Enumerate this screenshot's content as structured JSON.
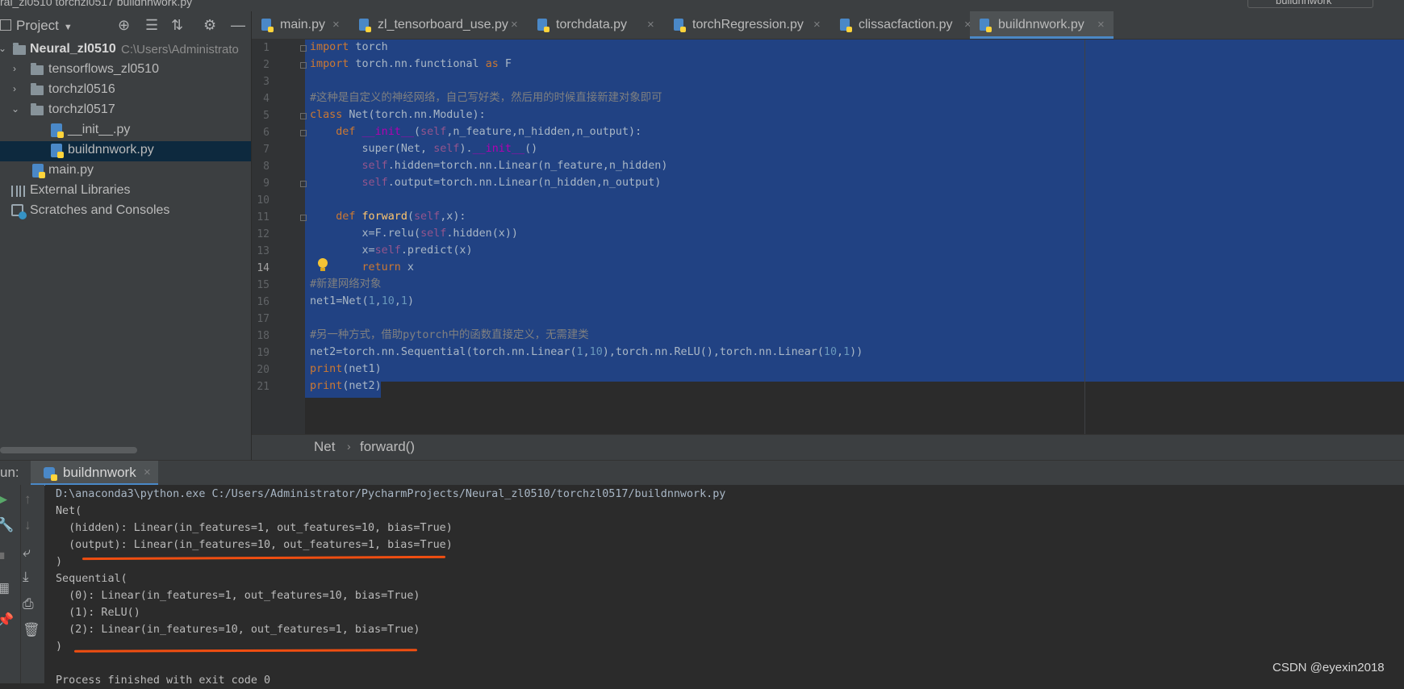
{
  "top_breadcrumb": "ral_zl0510  torchzl0517  buildnnwork.py",
  "run_config_label": "buildnnwork",
  "sidebar": {
    "title": "Project",
    "tools": {
      "locate": "⊕",
      "expand": "☰",
      "collapse": "⇅",
      "settings": "⚙",
      "hide": "—"
    },
    "tree": [
      {
        "label": "Neural_zl0510",
        "hint": "C:\\Users\\Administrato",
        "arrow": "⌄"
      },
      {
        "label": "tensorflows_zl0510",
        "arrow": "›"
      },
      {
        "label": "torchzl0516",
        "arrow": "›"
      },
      {
        "label": "torchzl0517",
        "arrow": "⌄"
      },
      {
        "label": "__init__.py"
      },
      {
        "label": "buildnnwork.py"
      },
      {
        "label": "main.py"
      },
      {
        "label": "External Libraries"
      },
      {
        "label": "Scratches and Consoles"
      }
    ]
  },
  "tabs": [
    {
      "label": "main.py"
    },
    {
      "label": "zl_tensorboard_use.py"
    },
    {
      "label": "torchdata.py"
    },
    {
      "label": "torchRegression.py"
    },
    {
      "label": "clissacfaction.py"
    },
    {
      "label": "buildnnwork.py"
    }
  ],
  "tab_close": "×",
  "editor": {
    "line_numbers": [
      "1",
      "2",
      "3",
      "4",
      "5",
      "6",
      "7",
      "8",
      "9",
      "10",
      "11",
      "12",
      "13",
      "14",
      "15",
      "16",
      "17",
      "18",
      "19",
      "20",
      "21"
    ],
    "code": {
      "l1_kw": "import",
      "l1_rest": " torch",
      "l2_kw": "import",
      "l2_a": " torch.nn.functional ",
      "l2_kw2": "as",
      "l2_b": " F",
      "l4": "#这种是自定义的神经网络，自己写好类，然后用的时候直接新建对象即可",
      "l5_kw": "class",
      "l5_rest": " Net(torch.nn.Module):",
      "l6_indent": "    ",
      "l6_kw": "def",
      "l6_sp": " ",
      "l6_fn": "__init__",
      "l6_a": "(",
      "l6_self": "self",
      "l6_b": ",n_feature,n_hidden,n_output):",
      "l7_a": "        super(Net, ",
      "l7_self": "self",
      "l7_b": ").",
      "l7_mag": "__init__",
      "l7_c": "()",
      "l8_indent": "        ",
      "l8_self": "self",
      "l8_rest": ".hidden=torch.nn.Linear(n_feature,n_hidden)",
      "l9_indent": "        ",
      "l9_self": "self",
      "l9_rest": ".output=torch.nn.Linear(n_hidden,n_output)",
      "l11_indent": "    ",
      "l11_kw": "def",
      "l11_sp": " ",
      "l11_fn": "forward",
      "l11_a": "(",
      "l11_self": "self",
      "l11_b": ",x):",
      "l12_a": "        x=F.relu(",
      "l12_self": "self",
      "l12_b": ".hidden(x))",
      "l13_a": "        x=",
      "l13_self": "self",
      "l13_b": ".predict(x)",
      "l14_indent": "        ",
      "l14_kw": "return",
      "l14_rest": " x",
      "l15": "#新建网络对象",
      "l16_a": "net1=Net(",
      "l16_n1": "1",
      "l16_c1": ",",
      "l16_n2": "10",
      "l16_c2": ",",
      "l16_n3": "1",
      "l16_b": ")",
      "l18": "#另一种方式，借助pytorch中的函数直接定义，无需建类",
      "l19_a": "net2=torch.nn.Sequential(torch.nn.Linear(",
      "l19_n1": "1",
      "l19_c1": ",",
      "l19_n2": "10",
      "l19_b": "),torch.nn.ReLU(),torch.nn.Linear(",
      "l19_n3": "10",
      "l19_c2": ",",
      "l19_n4": "1",
      "l19_c": "))",
      "l20_kw": "print",
      "l20_rest": "(net1)",
      "l21_kw": "print",
      "l21_rest": "(net2)"
    }
  },
  "breadcrumb_bar": {
    "item1": "Net",
    "separator": "›",
    "item2": "forward()"
  },
  "run": {
    "label": "un:",
    "tab": "buildnnwork",
    "output": [
      "D:\\anaconda3\\python.exe C:/Users/Administrator/PycharmProjects/Neural_zl0510/torchzl0517/buildnnwork.py",
      "Net(",
      "  (hidden): Linear(in_features=1, out_features=10, bias=True)",
      "  (output): Linear(in_features=10, out_features=1, bias=True)",
      ")",
      "Sequential(",
      "  (0): Linear(in_features=1, out_features=10, bias=True)",
      "  (1): ReLU()",
      "  (2): Linear(in_features=10, out_features=1, bias=True)",
      ")",
      "",
      "Process finished with exit code 0"
    ]
  },
  "watermark": "CSDN @eyexin2018",
  "colors": {
    "selection": "#214283",
    "annotation_underline": "#f04e11",
    "background": "#2b2b2b"
  }
}
